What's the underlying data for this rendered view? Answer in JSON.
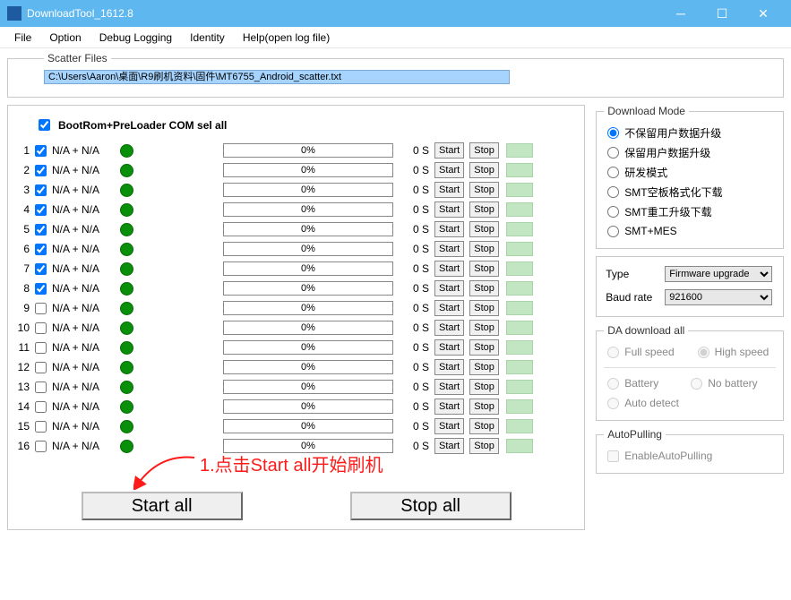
{
  "window": {
    "title": "DownloadTool_1612.8"
  },
  "menu": {
    "file": "File",
    "option": "Option",
    "debug": "Debug Logging",
    "identity": "Identity",
    "help": "Help(open log file)"
  },
  "scatter": {
    "legend": "Scatter Files",
    "path": "C:\\Users\\Aaron\\桌面\\R9刷机资料\\固件\\MT6755_Android_scatter.txt"
  },
  "selall_label": "BootRom+PreLoader COM sel all",
  "channels": [
    {
      "n": "1",
      "chk": true,
      "lbl": "N/A + N/A",
      "pct": "0%",
      "sec": "0 S"
    },
    {
      "n": "2",
      "chk": true,
      "lbl": "N/A + N/A",
      "pct": "0%",
      "sec": "0 S"
    },
    {
      "n": "3",
      "chk": true,
      "lbl": "N/A + N/A",
      "pct": "0%",
      "sec": "0 S"
    },
    {
      "n": "4",
      "chk": true,
      "lbl": "N/A + N/A",
      "pct": "0%",
      "sec": "0 S"
    },
    {
      "n": "5",
      "chk": true,
      "lbl": "N/A + N/A",
      "pct": "0%",
      "sec": "0 S"
    },
    {
      "n": "6",
      "chk": true,
      "lbl": "N/A + N/A",
      "pct": "0%",
      "sec": "0 S"
    },
    {
      "n": "7",
      "chk": true,
      "lbl": "N/A + N/A",
      "pct": "0%",
      "sec": "0 S"
    },
    {
      "n": "8",
      "chk": true,
      "lbl": "N/A + N/A",
      "pct": "0%",
      "sec": "0 S"
    },
    {
      "n": "9",
      "chk": false,
      "lbl": "N/A + N/A",
      "pct": "0%",
      "sec": "0 S"
    },
    {
      "n": "10",
      "chk": false,
      "lbl": "N/A + N/A",
      "pct": "0%",
      "sec": "0 S"
    },
    {
      "n": "11",
      "chk": false,
      "lbl": "N/A + N/A",
      "pct": "0%",
      "sec": "0 S"
    },
    {
      "n": "12",
      "chk": false,
      "lbl": "N/A + N/A",
      "pct": "0%",
      "sec": "0 S"
    },
    {
      "n": "13",
      "chk": false,
      "lbl": "N/A + N/A",
      "pct": "0%",
      "sec": "0 S"
    },
    {
      "n": "14",
      "chk": false,
      "lbl": "N/A + N/A",
      "pct": "0%",
      "sec": "0 S"
    },
    {
      "n": "15",
      "chk": false,
      "lbl": "N/A + N/A",
      "pct": "0%",
      "sec": "0 S"
    },
    {
      "n": "16",
      "chk": false,
      "lbl": "N/A + N/A",
      "pct": "0%",
      "sec": "0 S"
    }
  ],
  "row_btn": {
    "start": "Start",
    "stop": "Stop"
  },
  "download_mode": {
    "legend": "Download Mode",
    "opt1": "不保留用户数据升级",
    "opt2": "保留用户数据升级",
    "opt3": "研发模式",
    "opt4": "SMT空板格式化下载",
    "opt5": "SMT重工升级下载",
    "opt6": "SMT+MES"
  },
  "type": {
    "label": "Type",
    "value": "Firmware upgrade",
    "baud_label": "Baud rate",
    "baud_value": "921600"
  },
  "da": {
    "legend": "DA download all",
    "fullspeed": "Full speed",
    "highspeed": "High speed",
    "battery": "Battery",
    "nobattery": "No battery",
    "autodetect": "Auto detect"
  },
  "autopull": {
    "legend": "AutoPulling",
    "enable": "EnableAutoPulling"
  },
  "bigbtn": {
    "start": "Start all",
    "stop": "Stop all"
  },
  "annotation": "1.点击Start all开始刷机"
}
